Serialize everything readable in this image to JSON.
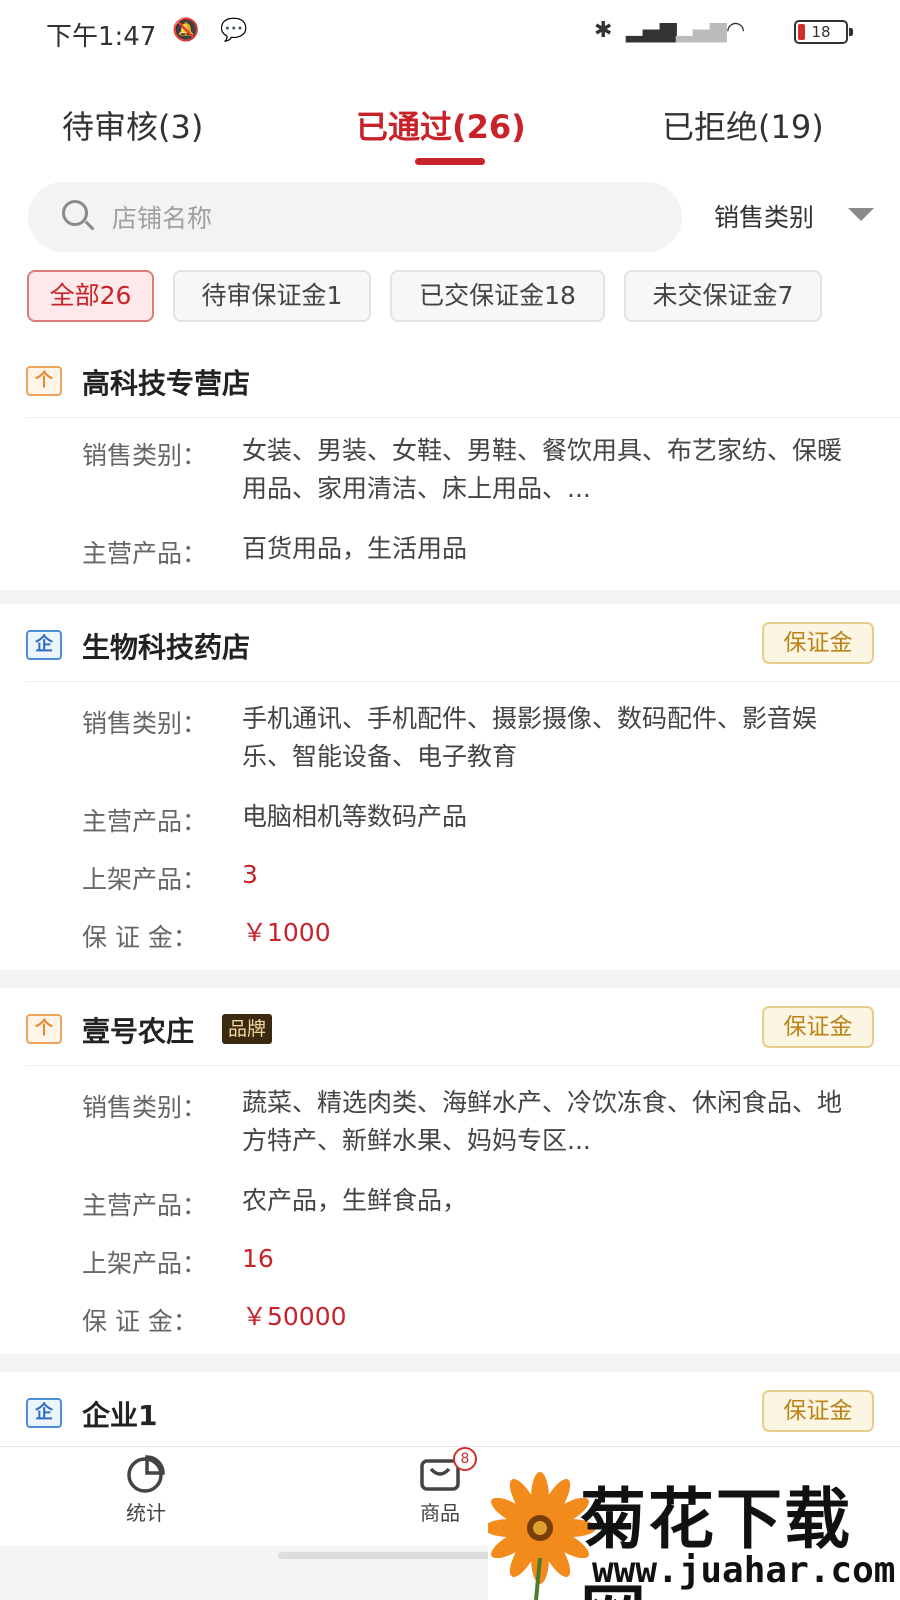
{
  "status_bar": {
    "time": "下午1:47",
    "battery": "18"
  },
  "tabs": [
    {
      "label": "待审核(3)"
    },
    {
      "label": "已通过(26)"
    },
    {
      "label": "已拒绝(19)"
    }
  ],
  "search": {
    "placeholder": "店铺名称",
    "category_filter": "销售类别"
  },
  "filter_chips": [
    {
      "label": "全部26"
    },
    {
      "label": "待审保证金1"
    },
    {
      "label": "已交保证金18"
    },
    {
      "label": "未交保证金7"
    }
  ],
  "labels": {
    "category": "销售类别：",
    "main_product": "主营产品：",
    "listed": "上架产品：",
    "deposit": "保 证 金：",
    "deposit_button": "保证金",
    "brand": "品牌",
    "type_personal": "个",
    "type_company": "企"
  },
  "stores": [
    {
      "name": "高科技专营店",
      "categories": "女装、男装、女鞋、男鞋、餐饮用具、布艺家纺、保暖用品、家用清洁、床上用品、...",
      "main_products": "百货用品，生活用品"
    },
    {
      "name": "生物科技药店",
      "categories": "手机通讯、手机配件、摄影摄像、数码配件、影音娱乐、智能设备、电子教育",
      "main_products": "电脑相机等数码产品",
      "listed": "3",
      "deposit": "￥1000"
    },
    {
      "name": "壹号农庄",
      "categories": "蔬菜、精选肉类、海鲜水产、冷饮冻食、休闲食品、地方特产、新鲜水果、妈妈专区...",
      "main_products": "农产品，生鲜食品，",
      "listed": "16",
      "deposit": "￥50000"
    },
    {
      "name": "企业1"
    }
  ],
  "bottom_nav": [
    {
      "label": "统计"
    },
    {
      "label": "商品",
      "badge": "8"
    }
  ],
  "watermark": {
    "title": "菊花下载网",
    "url": "www.juahar.com"
  }
}
